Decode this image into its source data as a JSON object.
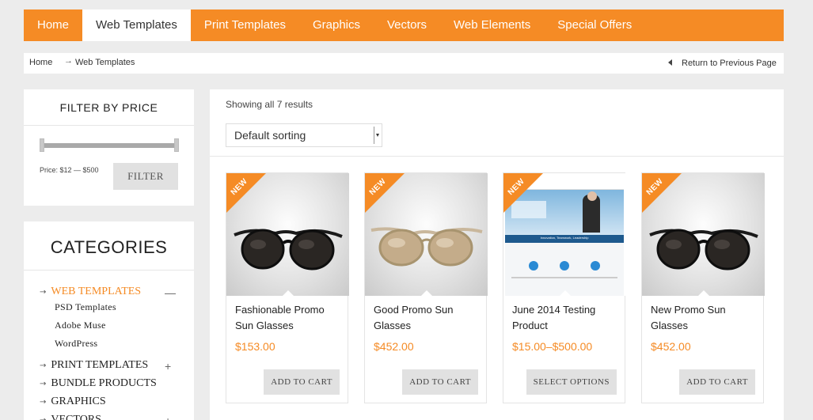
{
  "nav": {
    "items": [
      {
        "label": "Home"
      },
      {
        "label": "Web Templates",
        "active": true
      },
      {
        "label": "Print Templates"
      },
      {
        "label": "Graphics"
      },
      {
        "label": "Vectors"
      },
      {
        "label": "Web Elements"
      },
      {
        "label": "Special Offers"
      }
    ]
  },
  "breadcrumb": {
    "home": "Home",
    "current": "Web Templates",
    "back_label": "Return to Previous Page"
  },
  "price_filter": {
    "title": "FILTER BY PRICE",
    "range_text": "Price: $12 — $500",
    "button": "FILTER",
    "range_min": 0,
    "range_max": 1
  },
  "categories": {
    "title": "CATEGORIES",
    "items": [
      {
        "label": "WEB TEMPLATES",
        "toggle": "—",
        "sub": [
          "PSD Templates",
          "Adobe Muse",
          "WordPress"
        ]
      },
      {
        "label": "PRINT TEMPLATES",
        "toggle": "+"
      },
      {
        "label": "BUNDLE PRODUCTS"
      },
      {
        "label": "GRAPHICS"
      },
      {
        "label": "VECTORS",
        "toggle": "+"
      }
    ]
  },
  "results": {
    "showing": "Showing all 7 results",
    "sorting": "Default sorting"
  },
  "products": [
    {
      "name": "Fashionable Promo Sun Glasses",
      "price": "$153.00",
      "button": "ADD TO CART",
      "badge": "NEW"
    },
    {
      "name": "Good Promo Sun Glasses",
      "price": "$452.00",
      "button": "ADD TO CART",
      "badge": "NEW"
    },
    {
      "name": "June 2014 Testing Product",
      "price": "$15.00–$500.00",
      "button": "SELECT OPTIONS",
      "badge": "NEW",
      "thumb_text": "Innovation, Teamwork, Leadership"
    },
    {
      "name": "New Promo Sun Glasses",
      "price": "$452.00",
      "button": "ADD TO CART",
      "badge": "NEW"
    }
  ],
  "colors": {
    "accent": "#f58b25",
    "background": "#ececec"
  }
}
